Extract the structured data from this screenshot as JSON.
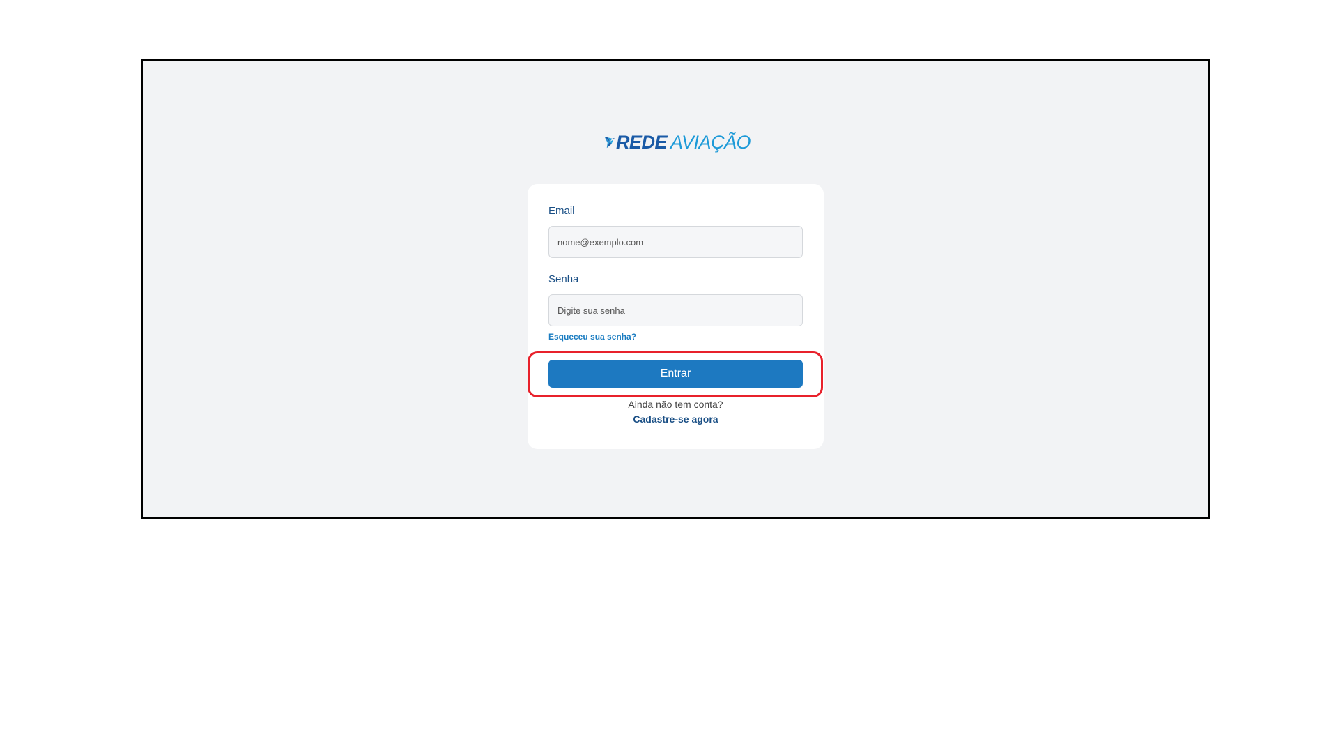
{
  "brand": {
    "name_strong": "REDE",
    "name_light": "AVIAÇÃO",
    "icon": "bird-logo-icon",
    "colors": {
      "dark_blue": "#1a5aa6",
      "light_blue": "#1d9ad8"
    }
  },
  "login_form": {
    "email_label": "Email",
    "email_placeholder": "nome@exemplo.com",
    "email_value": "",
    "password_label": "Senha",
    "password_placeholder": "Digite sua senha",
    "password_value": "",
    "forgot_password": "Esqueceu sua senha?",
    "submit_label": "Entrar",
    "signup_prompt": "Ainda não tem conta?",
    "signup_link": "Cadastre-se agora"
  },
  "colors": {
    "page_background": "#f2f3f5",
    "primary_button": "#1d79c1",
    "highlight_ring": "#e8212b",
    "label_text": "#1a4f85"
  }
}
